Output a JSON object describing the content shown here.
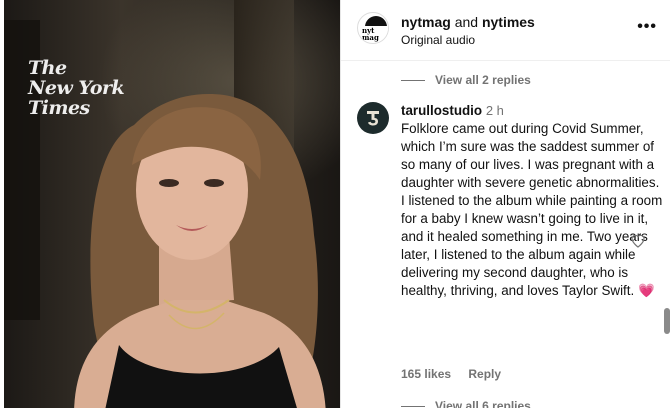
{
  "media": {
    "watermark_lines": [
      "The",
      "New York",
      "Times"
    ]
  },
  "header": {
    "account_1": "nytmag",
    "joiner": "and",
    "account_2": "nytimes",
    "subtitle": "Original audio",
    "more_label": "•••",
    "avatar_text": "nyt mag"
  },
  "thread": {
    "view_replies_top": "View all 2 replies",
    "view_replies_bottom": "View all 6 replies"
  },
  "comment": {
    "username": "tarullostudio",
    "time": "2 h",
    "text": "Folklore came out during Covid Summer, which I’m sure was the saddest summer of so many of our lives. I was pregnant with a daughter with severe genetic abnormalities. I listened to the album while painting a room for a baby I knew wasn’t going to live in it, and it healed something in me. Two years later, I listened to the album again while delivering my second daughter, who is healthy, thriving, and loves Taylor Swift.",
    "emoji": "💗",
    "likes": "165 likes",
    "reply_label": "Reply"
  },
  "colors": {
    "accent_heart": "#e8318a",
    "muted_text": "#737373",
    "avatar_bg": "#1d2b2c"
  }
}
